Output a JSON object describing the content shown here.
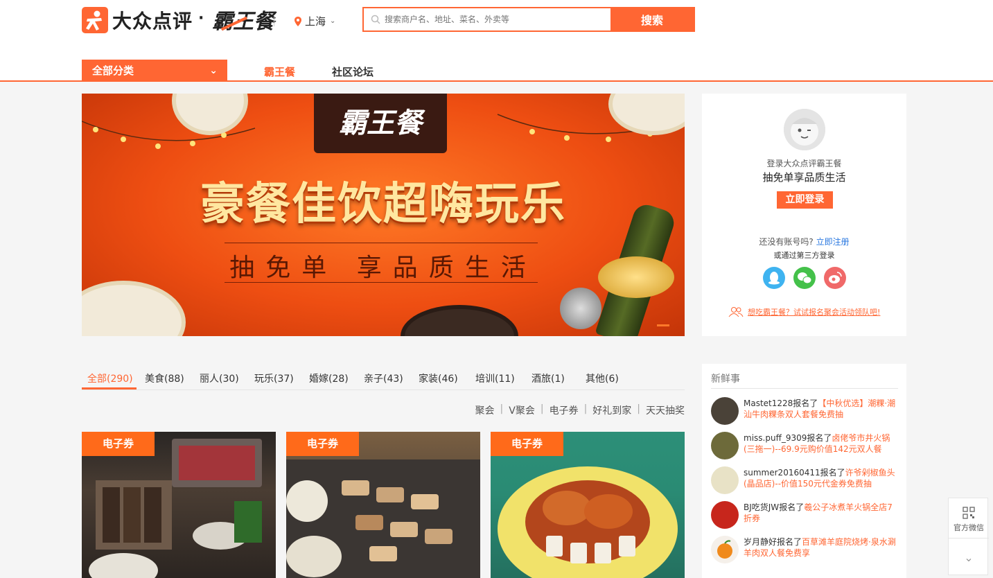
{
  "header": {
    "logo_text": "大众点评",
    "logo_dot": "·",
    "logo_sub": "霸王餐",
    "city": "上海",
    "search_placeholder": "搜索商户名、地址、菜名、外卖等",
    "search_button": "搜索"
  },
  "nav": {
    "all_categories": "全部分类",
    "items": [
      "霸王餐",
      "社区论坛"
    ]
  },
  "banner": {
    "sign": "霸王餐",
    "headline": "豪餐佳饮超嗨玩乐",
    "subline": "抽免单 享品质生活"
  },
  "login_panel": {
    "line1": "登录大众点评霸王餐",
    "line2": "抽免单享品质生活",
    "login_button": "立即登录",
    "no_account": "还没有账号吗?",
    "register_link": "立即注册",
    "third_party": "或通过第三方登录",
    "tip": "想吃霸王餐？试试报名聚会活动领队吧!"
  },
  "tabs": [
    {
      "label": "全部(290)",
      "active": true
    },
    {
      "label": "美食(88)"
    },
    {
      "label": "丽人(30)"
    },
    {
      "label": "玩乐(37)"
    },
    {
      "label": "婚嫁(28)"
    },
    {
      "label": "亲子(43)"
    },
    {
      "label": "家装(46)"
    },
    {
      "label": "培训(11)"
    },
    {
      "label": "酒旅(1)"
    },
    {
      "label": "其他(6)"
    }
  ],
  "filters": [
    "聚会",
    "V聚会",
    "电子券",
    "好礼到家",
    "天天抽奖"
  ],
  "cards": [
    {
      "badge": "电子券"
    },
    {
      "badge": "电子券"
    },
    {
      "badge": "电子券"
    }
  ],
  "news": {
    "title": "新鲜事",
    "items": [
      {
        "user": "Mastet1228",
        "action": "报名了",
        "deal": "【中秋优选】潮粿·潮汕牛肉粿条双人套餐免费抽"
      },
      {
        "user": "miss.puff_9309",
        "action": "报名了",
        "deal": "卤佬爷市井火锅(三拖一)--69.9元购价值142元双人餐"
      },
      {
        "user": "summer20160411",
        "action": "报名了",
        "deal": "许爷剁椒鱼头(晶品店)--价值150元代金券免费抽"
      },
      {
        "user": "BJ吃货JW",
        "action": "报名了",
        "deal": "羲公子冰煮羊火锅全店7折券"
      },
      {
        "user": "岁月静好",
        "action": "报名了",
        "deal": "百草滩羊庭院烧烤·泉水涮羊肉双人餐免费享"
      }
    ]
  },
  "float": {
    "wechat_label": "官方微信"
  },
  "colors": {
    "accent": "#ff6633",
    "link": "#2a78e0"
  }
}
